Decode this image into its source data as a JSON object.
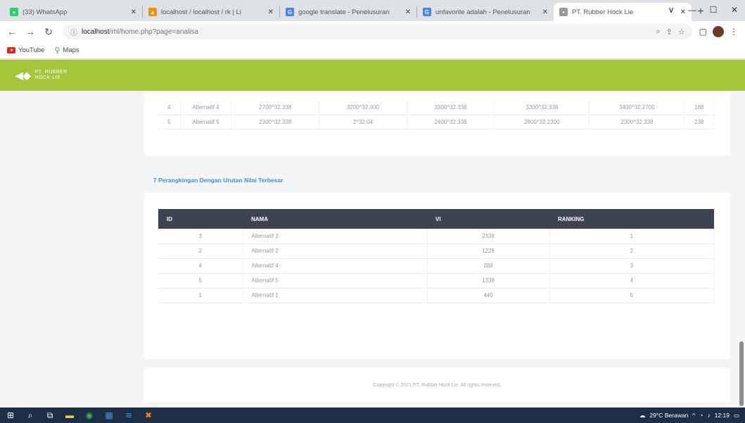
{
  "browser": {
    "tabs": [
      {
        "title": "(33) WhatsApp",
        "fav_color": "#25d366",
        "fav_glyph": "●",
        "active": false
      },
      {
        "title": "localhost / localhost / rk | Li",
        "fav_color": "#f29111",
        "fav_glyph": "▲",
        "active": false
      },
      {
        "title": "google translate - Penelusuran",
        "fav_color": "#4285f4",
        "fav_glyph": "G",
        "active": false
      },
      {
        "title": "unfavorite adalah - Penelusuran",
        "fav_color": "#4285f4",
        "fav_glyph": "G",
        "active": false
      },
      {
        "title": "PT. Rubber Hock Lie",
        "fav_color": "#999999",
        "fav_glyph": "•",
        "active": true
      }
    ],
    "new_tab": "+",
    "window_controls": [
      "∨",
      "—",
      "☐",
      "✕"
    ],
    "url_host": "localhost",
    "url_path": "/rhl/home.php?page=analisa",
    "bookmarks": [
      {
        "label": "YouTube",
        "icon": "youtube-icon"
      },
      {
        "label": "Maps",
        "icon": "maps-icon"
      }
    ]
  },
  "site": {
    "logo_line1": "PT. RUBBER",
    "logo_line2": "HOCK LIE"
  },
  "top_table": {
    "rows": [
      [
        "4",
        "Alternatif 4",
        "2700^32.338",
        "3200^32.000",
        "3300^32.338",
        "3300^32.338",
        "3400^32.2700",
        "188"
      ],
      [
        "5",
        "Alternatif 5",
        "2300^32.338",
        "2^32.04",
        "2400^32.338",
        "2800^32.2300",
        "2300^32.338",
        "238"
      ]
    ]
  },
  "ranking": {
    "section_title": "7 Perangkingan Dengan Urutan Nilai Terbesar",
    "headers": [
      "ID",
      "NAMA",
      "VI",
      "RANKING"
    ],
    "rows": [
      {
        "id": "3",
        "nama": "Alternatif 3",
        "vi": "2338",
        "rank": "1"
      },
      {
        "id": "2",
        "nama": "Alternatif 2",
        "vi": "1228",
        "rank": "2"
      },
      {
        "id": "4",
        "nama": "Alternatif 4",
        "vi": "288",
        "rank": "3"
      },
      {
        "id": "5",
        "nama": "Alternatif 5",
        "vi": "1338",
        "rank": "4"
      },
      {
        "id": "1",
        "nama": "Alternatif 1",
        "vi": "440",
        "rank": "5"
      }
    ]
  },
  "footer": {
    "text": "Copyright © 2021 PT. Rubber Hock Lie. All rights reserved."
  },
  "taskbar": {
    "weather": "29°C Berawan",
    "time": "12:19"
  }
}
